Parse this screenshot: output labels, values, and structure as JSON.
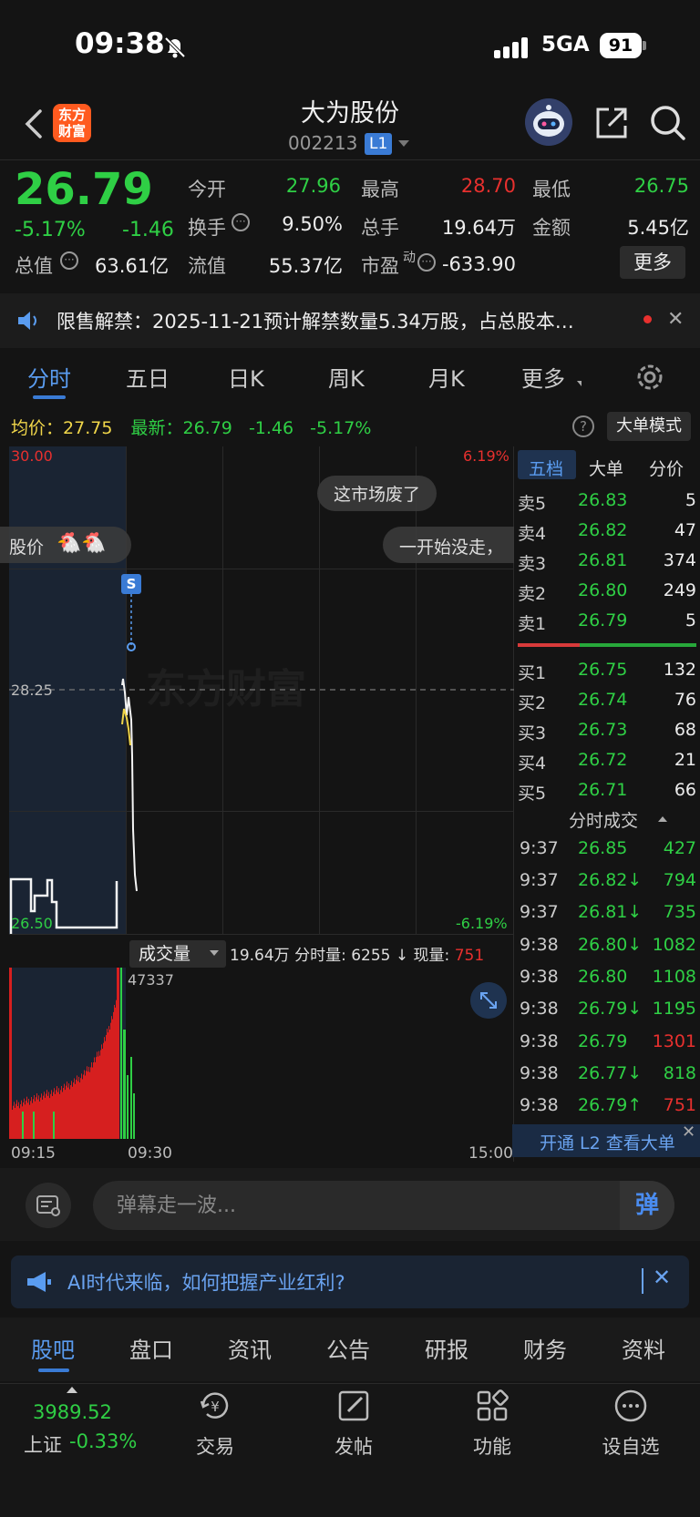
{
  "status": {
    "time": "09:38",
    "network": "5GA",
    "battery": "91"
  },
  "header": {
    "name": "大为股份",
    "code": "002213",
    "level": "L1",
    "logo": "东方\n财富"
  },
  "quote": {
    "price": "26.79",
    "pct": "-5.17%",
    "chg": "-1.46",
    "rows": [
      [
        {
          "l": "今开",
          "v": "27.96",
          "c": "green"
        },
        {
          "l": "最高",
          "v": "28.70",
          "c": "red"
        },
        {
          "l": "最低",
          "v": "26.75",
          "c": "green"
        }
      ],
      [
        {
          "l": "换手",
          "v": "9.50%",
          "c": "white"
        },
        {
          "l": "总手",
          "v": "19.64万",
          "c": "white"
        },
        {
          "l": "金额",
          "v": "5.45亿",
          "c": "white"
        }
      ]
    ],
    "zongzhi_label": "总值",
    "zongzhi": "63.61亿",
    "liuzhi_label": "流值",
    "liuzhi": "55.37亿",
    "shiying_label": "市盈",
    "shiying_sup": "动",
    "shiying": "-633.90",
    "more": "更多"
  },
  "notice": "限售解禁：2025-11-21预计解禁数量5.34万股，占总股本…",
  "chart_tabs": [
    "分时",
    "五日",
    "日K",
    "周K",
    "月K",
    "更多"
  ],
  "info": {
    "avg_label": "均价：",
    "avg": "27.75",
    "last_label": "最新：",
    "last": "26.79",
    "chg": "-1.46",
    "pct": "-5.17%",
    "big_order": "大单模式"
  },
  "chart": {
    "price_top": "30.00",
    "price_mid": "28.25",
    "price_bot": "26.50",
    "pct_top": "6.19%",
    "pct_bot": "-6.19%",
    "danmu": [
      "这市场废了",
      "股价",
      "一开始没走，"
    ],
    "signal": "S",
    "watermark": "东方财富"
  },
  "book": {
    "tabs": [
      "五档",
      "大单",
      "分价"
    ],
    "sell": [
      {
        "l": "卖5",
        "p": "26.83",
        "v": "5"
      },
      {
        "l": "卖4",
        "p": "26.82",
        "v": "47"
      },
      {
        "l": "卖3",
        "p": "26.81",
        "v": "374"
      },
      {
        "l": "卖2",
        "p": "26.80",
        "v": "249"
      },
      {
        "l": "卖1",
        "p": "26.79",
        "v": "5"
      }
    ],
    "buy": [
      {
        "l": "买1",
        "p": "26.75",
        "v": "132"
      },
      {
        "l": "买2",
        "p": "26.74",
        "v": "76"
      },
      {
        "l": "买3",
        "p": "26.73",
        "v": "68"
      },
      {
        "l": "买4",
        "p": "26.72",
        "v": "21"
      },
      {
        "l": "买5",
        "p": "26.71",
        "v": "66"
      }
    ],
    "ticks_title": "分时成交",
    "ticks": [
      {
        "t": "9:37",
        "p": "26.85",
        "v": "427",
        "c": "green"
      },
      {
        "t": "9:37",
        "p": "26.82↓",
        "v": "794",
        "c": "green"
      },
      {
        "t": "9:37",
        "p": "26.81↓",
        "v": "735",
        "c": "green"
      },
      {
        "t": "9:38",
        "p": "26.80↓",
        "v": "1082",
        "c": "green"
      },
      {
        "t": "9:38",
        "p": "26.80",
        "v": "1108",
        "c": "green"
      },
      {
        "t": "9:38",
        "p": "26.79↓",
        "v": "1195",
        "c": "green"
      },
      {
        "t": "9:38",
        "p": "26.79",
        "v": "1301",
        "c": "red"
      },
      {
        "t": "9:38",
        "p": "26.77↓",
        "v": "818",
        "c": "green"
      },
      {
        "t": "9:38",
        "p": "26.79↑",
        "v": "751",
        "c": "red"
      }
    ],
    "l2": "开通 L2 查看大单"
  },
  "volume": {
    "label": "成交量",
    "total": "19.64万",
    "fenshi_label": "分时量:",
    "fenshi": "6255",
    "xian_label": "现量:",
    "xian": "751",
    "max": "47337",
    "t_start": "09:15",
    "t_mid": "09:30",
    "t_end": "15:00"
  },
  "comment": {
    "placeholder": "弹幕走一波...",
    "send": "弹"
  },
  "ai_banner": "AI时代来临，如何把握产业红利?",
  "bottom_tabs": [
    "股吧",
    "盘口",
    "资讯",
    "公告",
    "研报",
    "财务",
    "资料"
  ],
  "index": {
    "value": "3989.52",
    "name": "上证",
    "pct": "-0.33%"
  },
  "nav": [
    "交易",
    "发帖",
    "功能",
    "设自选"
  ]
}
